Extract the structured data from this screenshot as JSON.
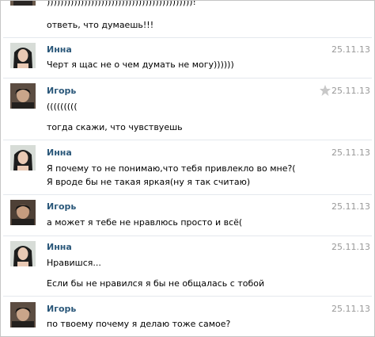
{
  "messages": [
    {
      "text_lines": [
        ")))))))))))))))))))))))))))))))))))))))))))!"
      ]
    },
    {
      "text_lines": [
        "ответь, что думаешь!!!"
      ]
    },
    {
      "author": "Инна",
      "date": "25.11.13",
      "text_lines": [
        "Черт я щас не о чем думать не могу))))))"
      ]
    },
    {
      "author": "Игорь",
      "date": "25.11.13",
      "text_lines": [
        "(((((((((",
        "тогда скажи, что чувствуешь"
      ]
    },
    {
      "author": "Инна",
      "date": "25.11.13",
      "text_lines": [
        "Я почему то не понимаю,что тебя привлекло во мне?(",
        "Я вроде бы не такая яркая(ну я так считаю)"
      ]
    },
    {
      "author": "Игорь",
      "date": "25.11.13",
      "text_lines": [
        "а может я тебе не нравлюсь просто и всё("
      ]
    },
    {
      "author": "Инна",
      "date": "25.11.13",
      "text_lines": [
        "Нравишся...",
        "Если бы не нравился я бы не общалась с тобой"
      ]
    },
    {
      "author": "Игорь",
      "date": "25.11.13",
      "text_lines": [
        "по твоему почему я делаю тоже самое?"
      ]
    }
  ],
  "icons": {
    "star": "star-icon",
    "avatar_inna": "avatar-inna",
    "avatar_igor": "avatar-igor"
  },
  "colors": {
    "author": "#2b587a",
    "date": "#999999",
    "separator": "#e4e8ed",
    "star": "#c8c8c8"
  }
}
